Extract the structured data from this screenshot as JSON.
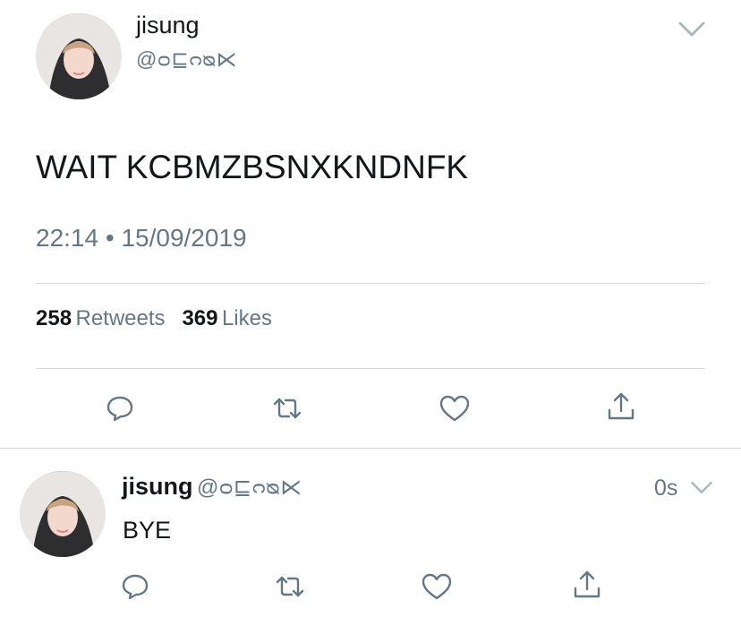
{
  "main_tweet": {
    "author_name": "jisung",
    "author_handle": "@ᴑ⊑ᴒᴓ⋉",
    "text": "WAIT KCBMZBSNXKNDNFK",
    "time": "22:14",
    "separator": "•",
    "date": "15/09/2019",
    "retweets_count": "258",
    "retweets_label": "Retweets",
    "likes_count": "369",
    "likes_label": "Likes"
  },
  "reply_tweet": {
    "author_name": "jisung",
    "author_handle": "@ᴑ⊑ᴒᴓ⋉",
    "time": "0s",
    "text": "BYE"
  },
  "icons": {
    "reply": "reply-icon",
    "retweet": "retweet-icon",
    "like": "heart-icon",
    "share": "share-icon",
    "menu": "chevron-down-icon"
  },
  "colors": {
    "icon_gray": "#657786",
    "divider": "#d8dde1",
    "text_primary": "#14171a"
  }
}
